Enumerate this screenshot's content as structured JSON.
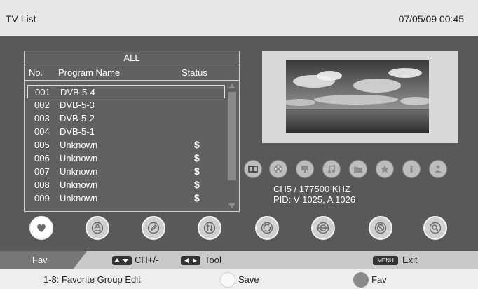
{
  "header": {
    "title": "TV List",
    "datetime": "07/05/09  00:45"
  },
  "list": {
    "group": "ALL",
    "columns": {
      "no": "No.",
      "name": "Program Name",
      "status": "Status"
    },
    "rows": [
      {
        "no": "001",
        "name": "DVB-5-4",
        "status": ""
      },
      {
        "no": "002",
        "name": "DVB-5-3",
        "status": ""
      },
      {
        "no": "003",
        "name": "DVB-5-2",
        "status": ""
      },
      {
        "no": "004",
        "name": "DVB-5-1",
        "status": ""
      },
      {
        "no": "005",
        "name": "Unknown",
        "status": "$"
      },
      {
        "no": "006",
        "name": "Unknown",
        "status": "$"
      },
      {
        "no": "007",
        "name": "Unknown",
        "status": "$"
      },
      {
        "no": "008",
        "name": "Unknown",
        "status": "$"
      },
      {
        "no": "009",
        "name": "Unknown",
        "status": "$"
      }
    ],
    "selected_index": 0
  },
  "channel_info": {
    "frequency": "CH5 / 177500  KHZ",
    "pid": "PID: V 1025, A 1026"
  },
  "status_icons": [
    "book-icon",
    "film-reel-icon",
    "tv-icon",
    "music-note-icon",
    "folder-icon",
    "star-icon",
    "info-icon",
    "person-icon"
  ],
  "function_buttons": [
    "heart-icon",
    "lock-icon",
    "pencil-icon",
    "sort-icon",
    "move-icon",
    "skip-icon",
    "delete-icon",
    "find-icon"
  ],
  "help_bar": {
    "mode": "Fav",
    "ch": "CH+/-",
    "tool": "Tool",
    "menu_key": "MENU",
    "exit": "Exit"
  },
  "bottom_bar": {
    "hint": "1-8: Favorite  Group  Edit",
    "save": "Save",
    "fav": "Fav"
  },
  "colors": {
    "save_dot": "#f0f0f0",
    "fav_dot": "#8a8a8a"
  }
}
